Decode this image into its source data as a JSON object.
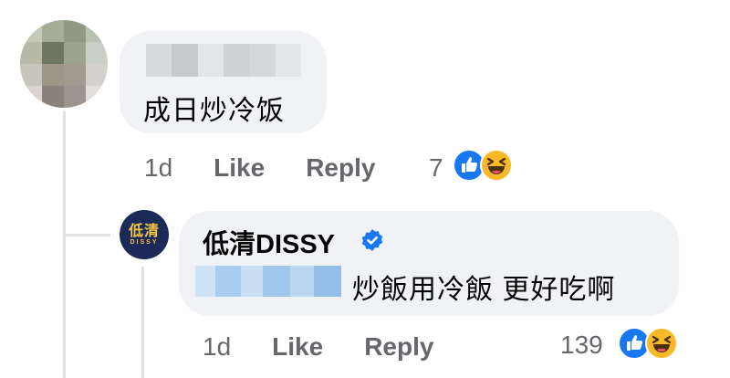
{
  "colors": {
    "bubble": "#f0f2f5",
    "meta_text": "#65676b",
    "like_blue": "#1877f2",
    "haha_yellow": "#f7b928",
    "verified_blue": "#1877f2",
    "thread_line": "#dfe1e5",
    "logo_navy": "#1b2a59",
    "logo_gold": "#f4c542"
  },
  "comment": {
    "author_name": "",
    "text": "成日炒冷饭",
    "actions": {
      "time": "1d",
      "like_label": "Like",
      "reply_label": "Reply"
    },
    "reaction_count": "7",
    "reaction_icons": [
      "like-icon",
      "haha-icon"
    ]
  },
  "reply": {
    "avatar_logo_main": "低清",
    "avatar_logo_sub": "DISSY",
    "author_name": "低清DISSY",
    "verified_icon": "verified-badge-icon",
    "text": "炒飯用冷飯 更好吃啊",
    "actions": {
      "time": "1d",
      "like_label": "Like",
      "reply_label": "Reply"
    },
    "reaction_count": "139",
    "reaction_icons": [
      "like-icon",
      "haha-icon"
    ]
  }
}
